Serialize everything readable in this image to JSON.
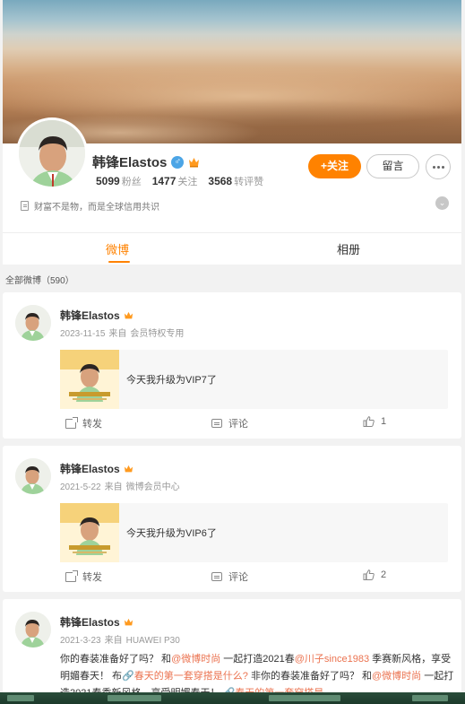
{
  "profile": {
    "name": "韩锋Elastos",
    "gender_badge": "♂",
    "followers_count": "5099",
    "followers_label": "粉丝",
    "following_count": "1477",
    "following_label": "关注",
    "reposts_comments_likes_count": "3568",
    "reposts_comments_likes_label": "转评赞",
    "follow_button": "+关注",
    "message_button": "留言",
    "bio": "财富不是物，而是全球信用共识"
  },
  "tabs": [
    {
      "label": "微博",
      "active": true
    },
    {
      "label": "相册",
      "active": false
    }
  ],
  "all_posts_label": "全部微博（590）",
  "posts": [
    {
      "author": "韩锋Elastos",
      "date": "2023-11-15",
      "source_prefix": "来自",
      "source": "会员特权专用",
      "share_text": "今天我升级为VIP7了",
      "repost_label": "转发",
      "comment_label": "评论",
      "like_count": "1"
    },
    {
      "author": "韩锋Elastos",
      "date": "2021-5-22",
      "source_prefix": "来自",
      "source": "微博会员中心",
      "share_text": "今天我升级为VIP6了",
      "repost_label": "转发",
      "comment_label": "评论",
      "like_count": "2"
    },
    {
      "author": "韩锋Elastos",
      "date": "2021-3-23",
      "source_prefix": "来自",
      "source": "HUAWEI P30",
      "text_1": "你的春装准备好了吗？ 和",
      "mention_1": "@微博时尚",
      "text_2": " 一起打造2021春",
      "mention_2": "@川子since1983",
      "text_3": " 季赛新风格，享受明媚春天！ 布",
      "topic_1": "🔗春天的第一套穿搭是什么?",
      "text_4": " 非你的春装准备好了吗？ 和",
      "mention_3": "@微博时尚",
      "text_5": " 一起打造2021春季新风格，享受明媚春天！ ",
      "topic_2": "🔗春天的第一套穿搭是"
    }
  ],
  "colors": {
    "accent": "#ff8200",
    "link": "#eb7350",
    "gender_badge": "#4ca5e6"
  },
  "icons": {
    "more": "more-icon",
    "gender": "male-icon",
    "vip": "crown-icon",
    "bio": "document-icon",
    "expand": "chevron-down-icon",
    "repost": "repost-icon",
    "comment": "comment-icon",
    "like": "thumbs-up-icon"
  }
}
